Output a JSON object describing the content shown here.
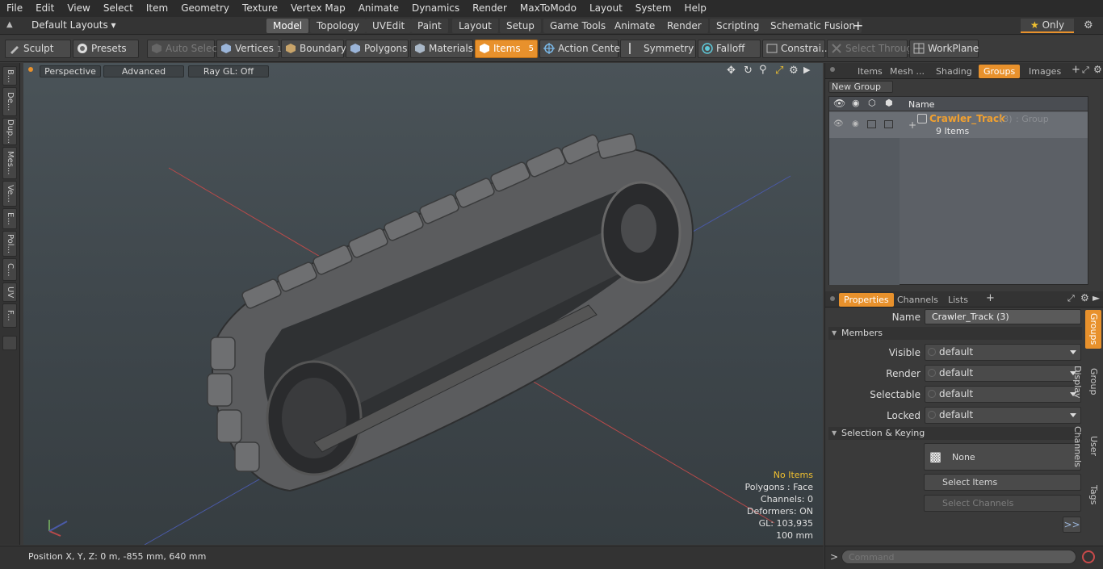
{
  "menu": [
    "File",
    "Edit",
    "View",
    "Select",
    "Item",
    "Geometry",
    "Texture",
    "Vertex Map",
    "Animate",
    "Dynamics",
    "Render",
    "MaxToModo",
    "Layout",
    "System",
    "Help"
  ],
  "layout_tabs": {
    "default_layouts": "Default Layouts",
    "tabs": [
      "Model",
      "Topology",
      "UVEdit",
      "Paint",
      "Layout",
      "Setup",
      "Game Tools",
      "Animate",
      "Render",
      "Scripting",
      "Schematic Fusion"
    ],
    "active": "Model",
    "only": "Only"
  },
  "toolbar": {
    "sculpt": "Sculpt",
    "presets": "Presets",
    "auto_select": "Auto Select",
    "vertices": "Vertices",
    "vertices_count": "1",
    "boundary": "Boundary",
    "polygons": "Polygons",
    "materials": "Materials",
    "items": "Items",
    "items_count": "5",
    "action_center": "Action Center",
    "symmetry": "Symmetry",
    "falloff": "Falloff",
    "constraints": "Constrai...",
    "select_through": "Select Through",
    "workplane": "WorkPlane"
  },
  "left_tools": [
    "B...",
    "De...",
    "Dup...",
    "Mes...",
    "Ve...",
    "E...",
    "Pol...",
    "C...",
    "UV",
    "F..."
  ],
  "viewport": {
    "perspective": "Perspective",
    "advanced": "Advanced",
    "raygl": "Ray GL: Off",
    "info": {
      "no_items": "No Items",
      "polygons": "Polygons : Face",
      "channels": "Channels: 0",
      "deformers": "Deformers: ON",
      "gl": "GL: 103,935",
      "scale": "100 mm"
    }
  },
  "status": {
    "position": "Position X, Y, Z:   0 m, -855 mm, 640 mm"
  },
  "groups_panel": {
    "tabs": [
      "Items",
      "Mesh ...",
      "Shading",
      "Groups",
      "Images"
    ],
    "active": "Groups",
    "new_group": "New Group",
    "col_name": "Name",
    "row": {
      "name": "Crawler_Track",
      "count": "(3)",
      "type": ": Group",
      "items": "9 Items"
    }
  },
  "properties": {
    "tabs": [
      "Properties",
      "Channels",
      "Lists"
    ],
    "active": "Properties",
    "name_label": "Name",
    "name_value": "Crawler_Track (3)",
    "members": "Members",
    "fields": [
      {
        "label": "Visible",
        "value": "default"
      },
      {
        "label": "Render",
        "value": "default"
      },
      {
        "label": "Selectable",
        "value": "default"
      },
      {
        "label": "Locked",
        "value": "default"
      }
    ],
    "selection_keying": "Selection & Keying",
    "none": "None",
    "select_items": "Select Items",
    "select_channels": "Select Channels",
    "more": ">>",
    "side_tabs": [
      "Groups",
      "Group Display",
      "User Channels",
      "Tags"
    ]
  },
  "command": {
    "placeholder": "Command"
  }
}
